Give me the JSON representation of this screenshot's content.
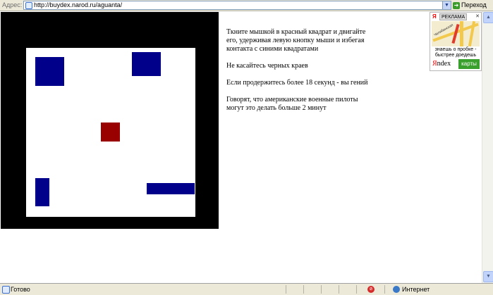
{
  "address_bar": {
    "label": "Адрес:",
    "url": "http://buydex.narod.ru/aguanta/",
    "go_label": "Переход"
  },
  "game": {
    "frame_color": "#000000",
    "arena_color": "#ffffff",
    "player_color": "#990000",
    "enemy_color": "#00008b"
  },
  "instructions": {
    "p1": "Ткните мышкой в красный квадрат и двигайте его, удерживая левую кнопку мыши и избегая контакта с синими квадратами",
    "p2": "Не касайтесь черных краев",
    "p3": "Если продержитесь более 18 секунд - вы гений",
    "p4": "Говорят, что американские военные пилоты могут это делать больше 2 минут"
  },
  "ad": {
    "label": "РЕКЛАМА",
    "ya_logo": "Я",
    "text": "знаешь о пробке - быстрее доедешь",
    "brand_y": "Я",
    "brand_rest": "ndex",
    "karty": "карты",
    "map_street": "Челябинская"
  },
  "status_bar": {
    "status": "Готово",
    "zone": "Интернет"
  },
  "icons": {
    "page": "page-icon",
    "go": "go-arrow-icon",
    "dropdown": "chevron-down-icon",
    "status": "page-icon",
    "zone": "globe-icon",
    "blocked": "popup-blocked-icon"
  }
}
